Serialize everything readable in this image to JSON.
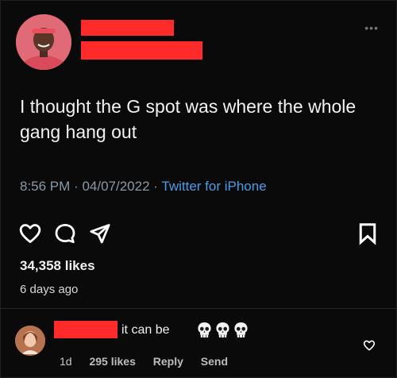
{
  "tweet": {
    "text": "I thought the G spot was where the whole gang hang out",
    "time": "8:56 PM",
    "date": "04/07/2022",
    "separator": "·",
    "source": "Twitter for iPhone",
    "more_label": "•••"
  },
  "stats": {
    "likes": "34,358 likes",
    "ago": "6 days ago"
  },
  "icons": {
    "like": "heart-icon",
    "comment": "comment-bubble-icon",
    "share": "send-icon",
    "save": "bookmark-icon"
  },
  "comment": {
    "text": "it can be",
    "emoji": [
      "skull",
      "skull",
      "skull"
    ],
    "time": "1d",
    "likes": "295 likes",
    "reply": "Reply",
    "send": "Send"
  },
  "colors": {
    "background": "#0a0a0a",
    "redaction": "#ff2b2b",
    "source_link": "#4a9de8"
  }
}
